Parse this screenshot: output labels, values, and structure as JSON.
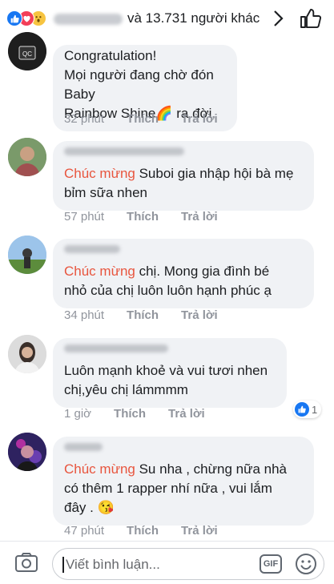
{
  "header": {
    "reactions": [
      "like",
      "love",
      "wow"
    ],
    "names_suffix": "và 13.731 người khác",
    "chevron": "›"
  },
  "comments": [
    {
      "tag": "",
      "text": "Congratulation!\nMọi người đang chờ đón Baby\nRainbow Shine🌈 ra đời.",
      "time": "32 phút",
      "like": "Thích",
      "reply": "Trả lời"
    },
    {
      "tag": "Chúc mừng",
      "text": " Suboi gia nhập hội bà mẹ\nbỉm sữa nhen",
      "time": "57 phút",
      "like": "Thích",
      "reply": "Trả lời"
    },
    {
      "tag": "Chúc mừng",
      "text": " chị. Mong gia đình bé\nnhỏ của chị luôn luôn hạnh phúc ạ",
      "time": "34 phút",
      "like": "Thích",
      "reply": "Trả lời"
    },
    {
      "tag": "",
      "text": "Luôn mạnh khoẻ và vui tươi nhen\nchị,yêu chị lámmmm",
      "time": "1 giờ",
      "like": "Thích",
      "reply": "Trả lời",
      "reaction_count": "1"
    },
    {
      "tag": "Chúc mừng",
      "text": "  Su nha  , chừng nữa nhà\ncó thêm 1 rapper nhí nữa , vui lắm\nđây . 😘",
      "time": "47 phút",
      "like": "Thích",
      "reply": "Trả lời"
    }
  ],
  "composer": {
    "placeholder": "Viết bình luận...",
    "gif_label": "GIF"
  },
  "colors": {
    "tag": "#e8553e",
    "bubble": "#f0f2f5",
    "meta": "#90949c",
    "like_blue": "#1877f2"
  },
  "icons": [
    "like-reaction-icon",
    "love-reaction-icon",
    "wow-reaction-icon",
    "chevron-right-icon",
    "thumbs-up-icon",
    "camera-icon",
    "gif-icon",
    "emoji-icon"
  ]
}
